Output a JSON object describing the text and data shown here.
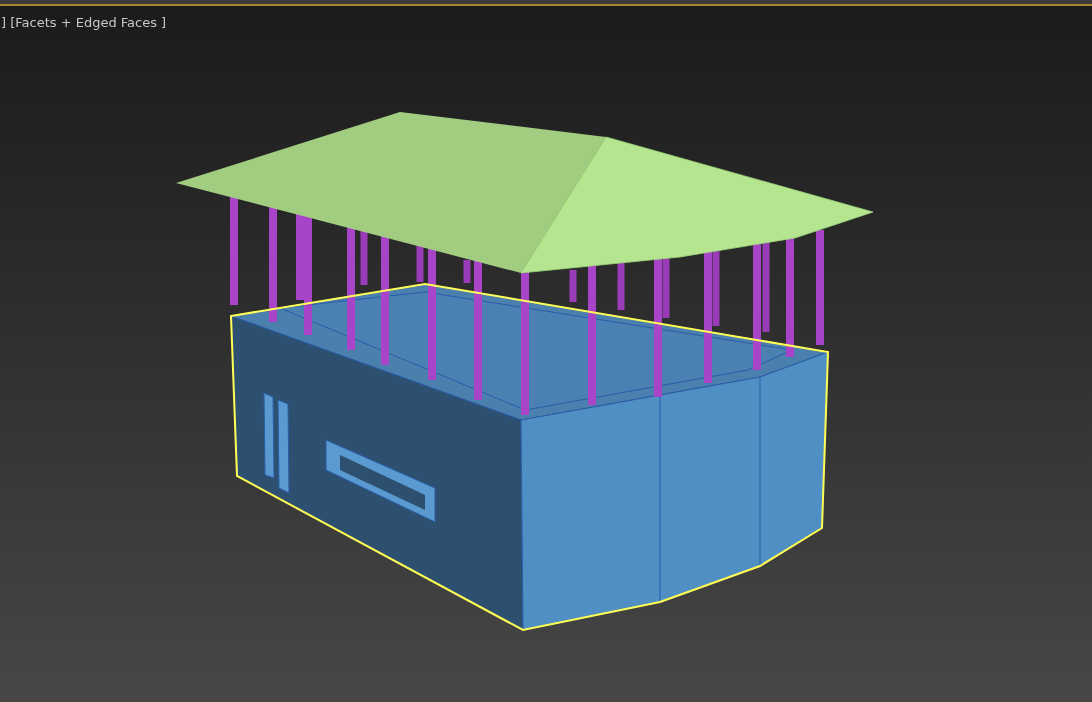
{
  "viewport": {
    "label": "] [Facets + Edged Faces ]"
  }
}
